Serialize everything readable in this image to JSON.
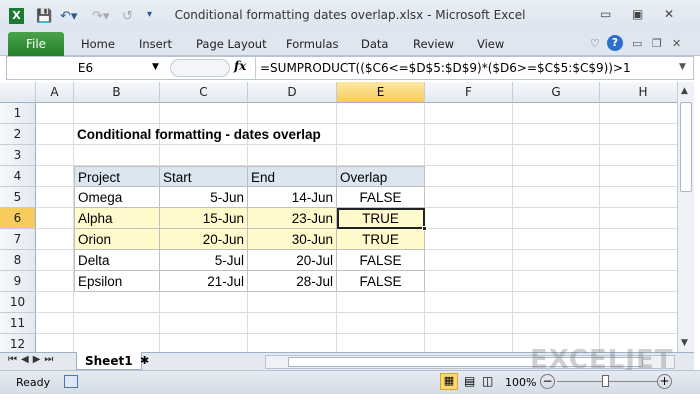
{
  "window": {
    "title": "Conditional formatting dates overlap.xlsx  -  Microsoft Excel"
  },
  "ribbon": {
    "tabs": [
      "File",
      "Home",
      "Insert",
      "Page Layout",
      "Formulas",
      "Data",
      "Review",
      "View"
    ]
  },
  "formula_bar": {
    "name_box": "E6",
    "fx": "fx",
    "formula": "=SUMPRODUCT(($C6<=$D$5:$D$9)*($D6>=$C$5:$C$9))>1"
  },
  "columns": [
    "A",
    "B",
    "C",
    "D",
    "E",
    "F",
    "G",
    "H"
  ],
  "rows": [
    "1",
    "2",
    "3",
    "4",
    "5",
    "6",
    "7",
    "8",
    "9",
    "10",
    "11",
    "12"
  ],
  "sheet": {
    "title": "Conditional formatting - dates overlap",
    "headers": [
      "Project",
      "Start",
      "End",
      "Overlap"
    ],
    "data": [
      [
        "Omega",
        "5-Jun",
        "14-Jun",
        "FALSE"
      ],
      [
        "Alpha",
        "15-Jun",
        "23-Jun",
        "TRUE"
      ],
      [
        "Orion",
        "20-Jun",
        "30-Jun",
        "TRUE"
      ],
      [
        "Delta",
        "5-Jul",
        "20-Jul",
        "FALSE"
      ],
      [
        "Epsilon",
        "21-Jul",
        "28-Jul",
        "FALSE"
      ]
    ],
    "highlight_color": "#fff9cc",
    "header_color": "#dce6f1"
  },
  "tabs": {
    "sheet1": "Sheet1"
  },
  "status": {
    "ready": "Ready",
    "zoom": "100%"
  },
  "watermark": "EXCELJET"
}
